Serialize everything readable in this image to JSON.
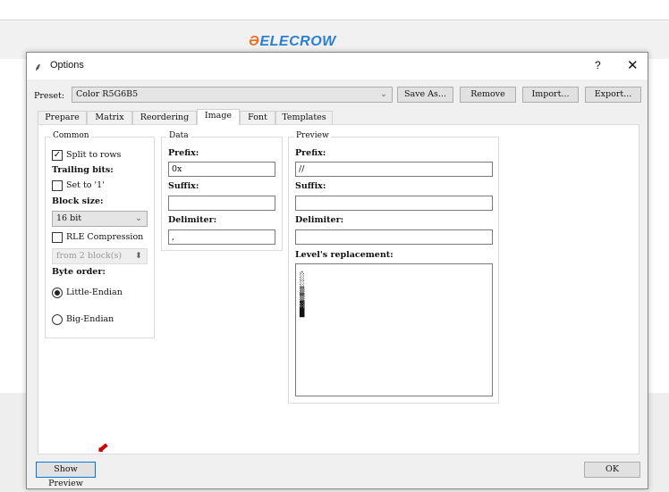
{
  "brand": {
    "logo_left": "Ə",
    "logo_text": "ELECROW"
  },
  "dialog": {
    "title": "Options",
    "help": "?",
    "close": "✕"
  },
  "preset": {
    "label": "Preset:",
    "value": "Color R5G6B5",
    "buttons": [
      "Save As...",
      "Remove",
      "Import...",
      "Export..."
    ]
  },
  "tabs": [
    "Prepare",
    "Matrix",
    "Reordering",
    "Image",
    "Font",
    "Templates"
  ],
  "active_tab": "Image",
  "common": {
    "title": "Common",
    "split_rows": "Split to rows",
    "split_rows_checked": true,
    "trailing_bits": "Trailing bits:",
    "set_to_1": "Set to '1'",
    "set_to_1_checked": false,
    "block_size": "Block size:",
    "block_size_value": "16 bit",
    "rle": "RLE Compression",
    "rle_checked": false,
    "from_blocks": "from 2 block(s)",
    "byte_order": "Byte order:",
    "little_endian": "Little-Endian",
    "big_endian": "Big-Endian",
    "selected_order": "Little-Endian"
  },
  "data": {
    "title": "Data",
    "prefix_label": "Prefix:",
    "prefix": "0x",
    "suffix_label": "Suffix:",
    "suffix": "",
    "delimiter_label": "Delimiter:",
    "delimiter": ","
  },
  "preview": {
    "title": "Preview",
    "prefix_label": "Prefix:",
    "prefix": "//",
    "suffix_label": "Suffix:",
    "suffix": "",
    "delimiter_label": "Delimiter:",
    "delimiter": "",
    "levels_label": "Level's replacement:",
    "levels": [
      ".",
      "░",
      "░",
      "▒",
      "▒",
      "▓",
      "█"
    ]
  },
  "footer": {
    "show_preview": "Show Preview",
    "ok": "OK"
  }
}
